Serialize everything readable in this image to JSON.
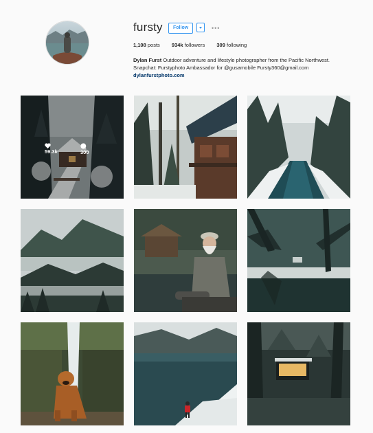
{
  "profile": {
    "username": "fursty",
    "follow_label": "Follow",
    "more_label": "•••",
    "stats": {
      "posts_count": "1,108",
      "posts_label": "posts",
      "followers_count": "934k",
      "followers_label": "followers",
      "following_count": "309",
      "following_label": "following"
    },
    "bio": {
      "name": "Dylan Furst",
      "text": "Outdoor adventure and lifestyle photographer from the Pacific Northwest. Snapchat: Furstyphoto Ambassador for @gusamobile Fursty360@gmail.com",
      "link": "dylanfurstphoto.com"
    }
  },
  "posts": [
    {
      "alt": "snowy-cabin-in-forest",
      "likes": "59.3k",
      "comments": "300"
    },
    {
      "alt": "treehouse-in-snowy-forest"
    },
    {
      "alt": "frozen-river-in-forest"
    },
    {
      "alt": "misty-forest-hills"
    },
    {
      "alt": "old-man-by-lake"
    },
    {
      "alt": "snowy-lake-through-branches"
    },
    {
      "alt": "dog-by-waterfall"
    },
    {
      "alt": "person-on-snowy-lakeshore"
    },
    {
      "alt": "lit-cabin-in-dark-forest"
    }
  ],
  "colors": {
    "accent": "#3897f0",
    "link": "#003569",
    "background": "#fafafa"
  }
}
